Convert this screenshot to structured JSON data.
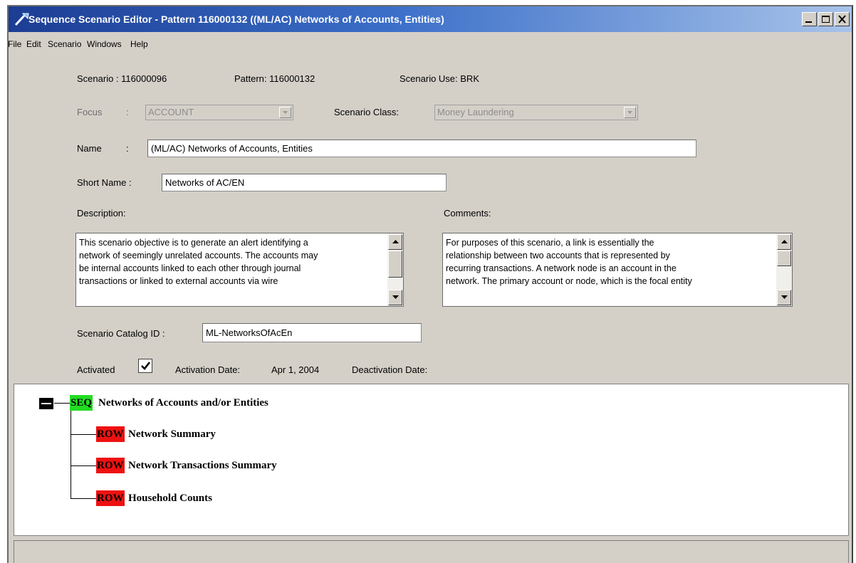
{
  "window": {
    "title": "Sequence Scenario Editor - Pattern 116000132 ((ML/AC) Networks of Accounts, Entities)"
  },
  "menu": [
    "File",
    "Edit",
    "Scenario",
    "Windows",
    "Help"
  ],
  "header": {
    "scenario": "Scenario : 116000096",
    "pattern": "Pattern: 116000132",
    "scenario_use": "Scenario Use: BRK"
  },
  "form": {
    "focus_label": "Focus",
    "colon": ":",
    "focus_value": "ACCOUNT",
    "scenario_class_label": "Scenario Class:",
    "scenario_class_value": "Money Laundering",
    "name_label": "Name",
    "name_value": "(ML/AC) Networks of Accounts, Entities",
    "short_name_label": "Short Name :",
    "short_name_value": "Networks of AC/EN",
    "description_label": "Description:",
    "description_lines": [
      "This scenario objective is to generate an alert identifying a",
      "network of seemingly unrelated accounts. The accounts may",
      "be internal accounts linked to each other through journal",
      "transactions or linked to external accounts via wire"
    ],
    "comments_label": "Comments:",
    "comments_lines": [
      "For purposes of this scenario, a link is essentially the",
      "relationship between two accounts that is represented by",
      "recurring transactions. A network node is an account in the",
      "network. The primary account or node, which is the focal entity"
    ],
    "catalog_label": "Scenario Catalog ID :",
    "catalog_value": "ML-NetworksOfAcEn",
    "activated_label": "Activated",
    "activated_checked": true,
    "activation_date_label": "Activation Date:",
    "activation_date_value": "Apr 1, 2004",
    "deactivation_date_label": "Deactivation Date:"
  },
  "tree": {
    "root": {
      "tag": "SEQ",
      "label": "Networks of Accounts and/or Entities",
      "tag_color": "#22dd22"
    },
    "children": [
      {
        "tag": "ROW",
        "label": "Network Summary"
      },
      {
        "tag": "ROW",
        "label": "Network Transactions Summary"
      },
      {
        "tag": "ROW",
        "label": "Household Counts"
      }
    ],
    "child_tag_color": "#ee1111"
  },
  "colors": {
    "titlebar_start": "#1c3d93",
    "titlebar_end": "#a8c3ea",
    "window_bg": "#d4d0c8"
  }
}
